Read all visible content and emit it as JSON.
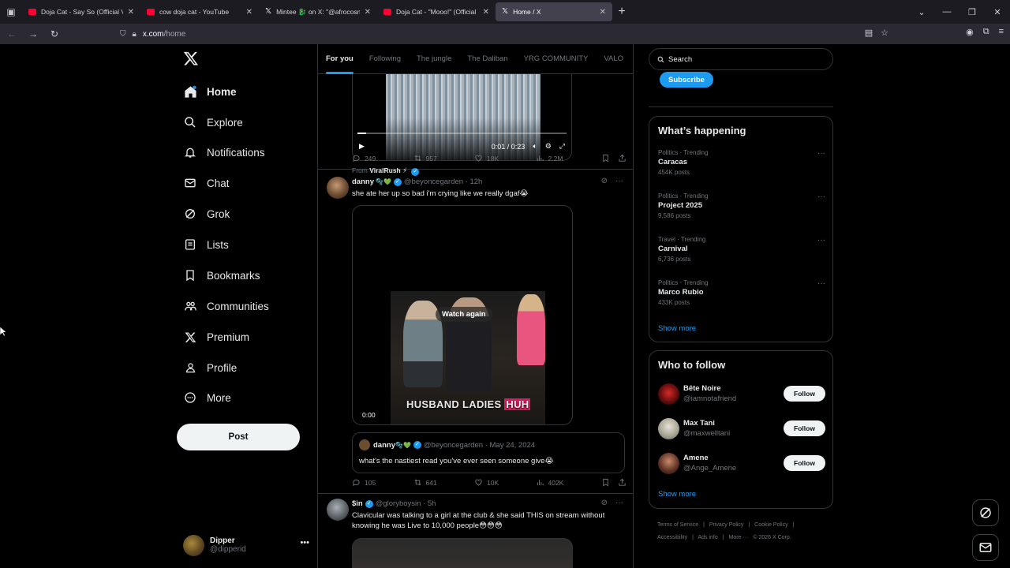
{
  "browser": {
    "tabs": [
      {
        "title": "Doja Cat - Say So (Official V",
        "favicon": "youtube",
        "active": false
      },
      {
        "title": "cow doja cat - YouTube",
        "favicon": "youtube",
        "active": false
      },
      {
        "title": "Mintee 🐉 on X: \"@afrocosmist",
        "favicon": "x",
        "active": false
      },
      {
        "title": "Doja Cat - \"Mooo!\" (Official Vid",
        "favicon": "youtube",
        "active": false
      },
      {
        "title": "Home / X",
        "favicon": "x",
        "active": true
      }
    ],
    "url_domain": "x.com",
    "url_path": "/home"
  },
  "sidebar": {
    "items": [
      {
        "label": "Home",
        "icon": "home-icon"
      },
      {
        "label": "Explore",
        "icon": "search-icon"
      },
      {
        "label": "Notifications",
        "icon": "bell-icon"
      },
      {
        "label": "Chat",
        "icon": "mail-icon"
      },
      {
        "label": "Grok",
        "icon": "grok-icon"
      },
      {
        "label": "Lists",
        "icon": "list-icon"
      },
      {
        "label": "Bookmarks",
        "icon": "bookmark-icon"
      },
      {
        "label": "Communities",
        "icon": "people-icon"
      },
      {
        "label": "Premium",
        "icon": "x-icon"
      },
      {
        "label": "Profile",
        "icon": "person-icon"
      },
      {
        "label": "More",
        "icon": "more-circle-icon"
      }
    ],
    "post_label": "Post",
    "account": {
      "name": "Dipper",
      "handle": "@dipperid"
    }
  },
  "feed": {
    "tabs": [
      "For you",
      "Following",
      "The jungle",
      "The Daliban",
      "YRG COMMUNITY",
      "VALO"
    ],
    "tweet1": {
      "video_time": "0:01 / 0:23",
      "video_progress": 0.04,
      "from_label": "From",
      "from_name": "ViralRush ⚡",
      "replies": "249",
      "reposts": "957",
      "likes": "18K",
      "views": "2.2M"
    },
    "tweet2": {
      "name": "danny",
      "name_emoji": "🫧💚",
      "handle_time": "@beyoncegarden · 12h",
      "text": "she ate her up so bad i'm crying like we really dgaf😭",
      "watch_again": "Watch again",
      "caption_1": "HUSBAND LADIES ",
      "caption_2": "HUH",
      "video_time": "0:00",
      "quote": {
        "name": "danny",
        "name_emoji": "🫧💚",
        "handle_time": "@beyoncegarden · May 24, 2024",
        "text": "what's the nastiest read you've ever seen someone give😭"
      },
      "replies": "105",
      "reposts": "641",
      "likes": "10K",
      "views": "402K"
    },
    "tweet3": {
      "name": "$in",
      "handle_time": "@gloryboysin · 5h",
      "text": "Clavicular was talking to a girl at the club & she said THIS on stream without knowing he was Live to 10,000 people😳😳😳"
    }
  },
  "right": {
    "search_placeholder": "Search",
    "subscribe_label": "Subscribe",
    "happening_title": "What’s happening",
    "trends": [
      {
        "category": "Politics · Trending",
        "name": "Caracas",
        "count": "454K posts"
      },
      {
        "category": "Politics · Trending",
        "name": "Project 2025",
        "count": "9,586 posts"
      },
      {
        "category": "Travel · Trending",
        "name": "Carnival",
        "count": "6,736 posts"
      },
      {
        "category": "Politics · Trending",
        "name": "Marco Rubio",
        "count": "433K posts"
      }
    ],
    "show_more": "Show more",
    "who_title": "Who to follow",
    "follows": [
      {
        "name": "Bête Noire",
        "handle": "@iamnotafriend"
      },
      {
        "name": "Max Tani",
        "handle": "@maxwelltani"
      },
      {
        "name": "Amene",
        "handle": "@Ange_Amene"
      }
    ],
    "follow_label": "Follow",
    "footer_line1": [
      "Terms of Service",
      "|",
      "Privacy Policy",
      "|",
      "Cookie Policy",
      "|"
    ],
    "footer_line2": [
      "Accessibility",
      "|",
      "Ads info",
      "|",
      "More ···",
      "© 2026 X Corp."
    ]
  },
  "colors": {
    "accent": "#1d9bf0",
    "border": "#2f3336",
    "muted": "#71767b",
    "text": "#e7e9ea"
  }
}
